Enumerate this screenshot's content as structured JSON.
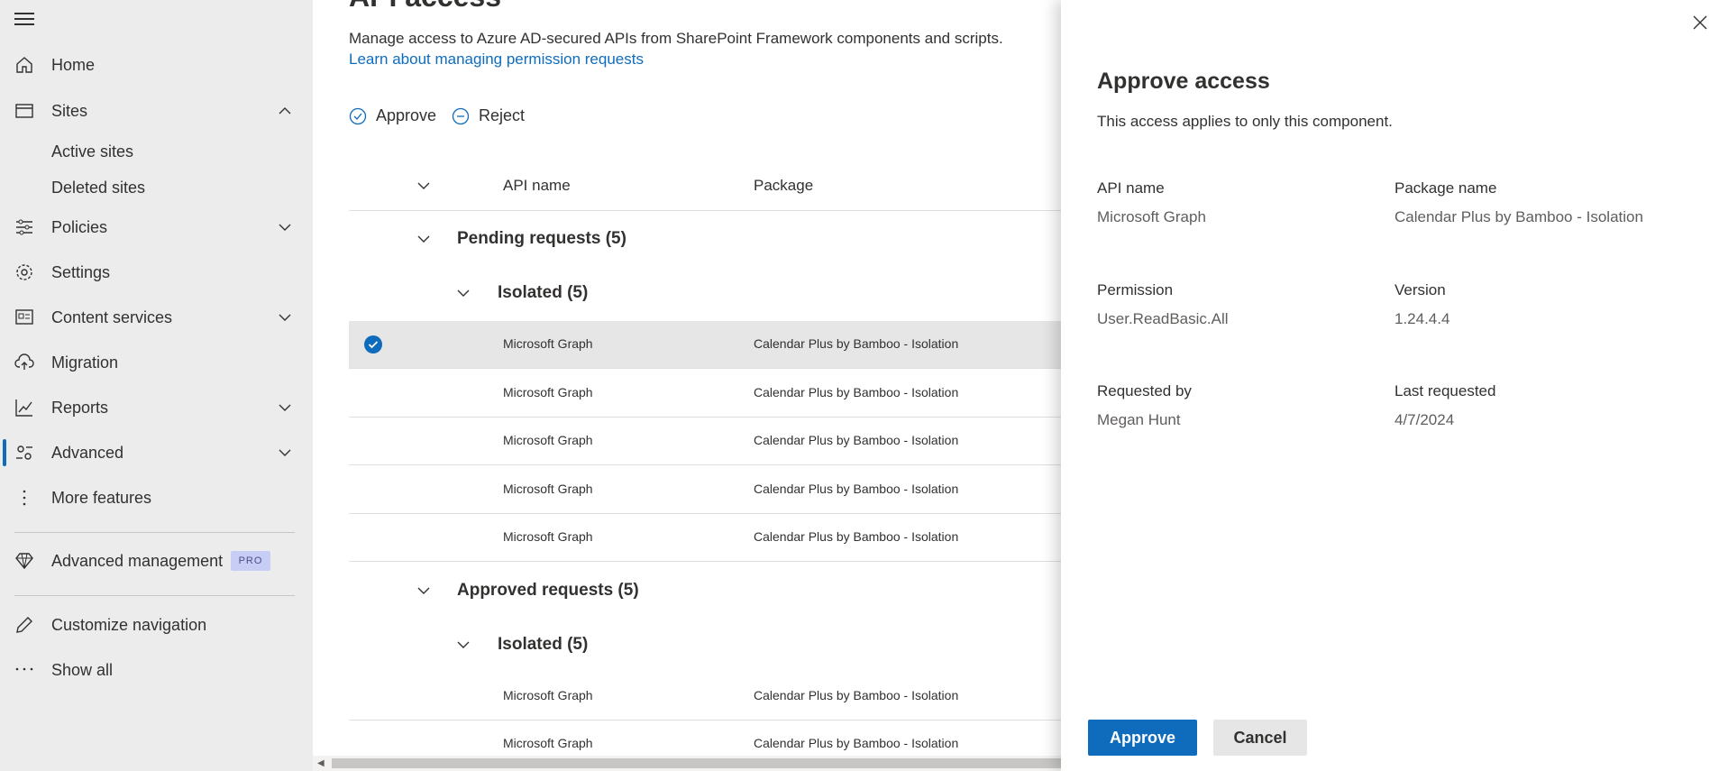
{
  "sidebar": {
    "items": [
      {
        "label": "Home",
        "icon": "home-icon"
      },
      {
        "label": "Sites",
        "icon": "sites-icon"
      },
      {
        "label": "Policies",
        "icon": "policies-icon"
      },
      {
        "label": "Settings",
        "icon": "gear-icon"
      },
      {
        "label": "Content services",
        "icon": "content-services-icon"
      },
      {
        "label": "Migration",
        "icon": "cloud-upload-icon"
      },
      {
        "label": "Reports",
        "icon": "chart-line-icon"
      },
      {
        "label": "Advanced",
        "icon": "advanced-gears-icon"
      },
      {
        "label": "More features",
        "icon": "more-vertical-icon"
      },
      {
        "label": "Advanced management",
        "icon": "diamond-icon",
        "badge": "PRO"
      },
      {
        "label": "Customize navigation",
        "icon": "pencil-icon"
      },
      {
        "label": "Show all",
        "icon": "ellipsis-icon"
      }
    ],
    "sites_subitems": [
      "Active sites",
      "Deleted sites"
    ]
  },
  "main": {
    "title": "API access",
    "description": "Manage access to Azure AD-secured APIs from SharePoint Framework components and scripts.",
    "learn_link": "Learn about managing permission requests",
    "commands": {
      "approve": "Approve",
      "reject": "Reject"
    },
    "columns": {
      "api_name": "API name",
      "package": "Package"
    },
    "pending_group": "Pending requests (5)",
    "pending_subgroup": "Isolated (5)",
    "pending_rows": [
      {
        "api": "Microsoft Graph",
        "package": "Calendar Plus by Bamboo - Isolation"
      },
      {
        "api": "Microsoft Graph",
        "package": "Calendar Plus by Bamboo - Isolation"
      },
      {
        "api": "Microsoft Graph",
        "package": "Calendar Plus by Bamboo - Isolation"
      },
      {
        "api": "Microsoft Graph",
        "package": "Calendar Plus by Bamboo - Isolation"
      },
      {
        "api": "Microsoft Graph",
        "package": "Calendar Plus by Bamboo - Isolation"
      }
    ],
    "approved_group": "Approved requests (5)",
    "approved_subgroup": "Isolated (5)",
    "approved_rows": [
      {
        "api": "Microsoft Graph",
        "package": "Calendar Plus by Bamboo - Isolation"
      },
      {
        "api": "Microsoft Graph",
        "package": "Calendar Plus by Bamboo - Isolation"
      }
    ]
  },
  "panel": {
    "title": "Approve access",
    "subtitle": "This access applies to only this component.",
    "fields": {
      "api_name_label": "API name",
      "api_name_value": "Microsoft Graph",
      "package_label": "Package name",
      "package_value": "Calendar Plus by Bamboo - Isolation",
      "permission_label": "Permission",
      "permission_value": "User.ReadBasic.All",
      "version_label": "Version",
      "version_value": "1.24.4.4",
      "requested_by_label": "Requested by",
      "requested_by_value": "Megan Hunt",
      "last_requested_label": "Last requested",
      "last_requested_value": "4/7/2024"
    },
    "approve_button": "Approve",
    "cancel_button": "Cancel"
  },
  "colors": {
    "accent": "#0f6cbd",
    "sidebar_bg": "#ececec",
    "selected_row": "#e6e6e6",
    "pro_badge": "#c7cdf5"
  }
}
